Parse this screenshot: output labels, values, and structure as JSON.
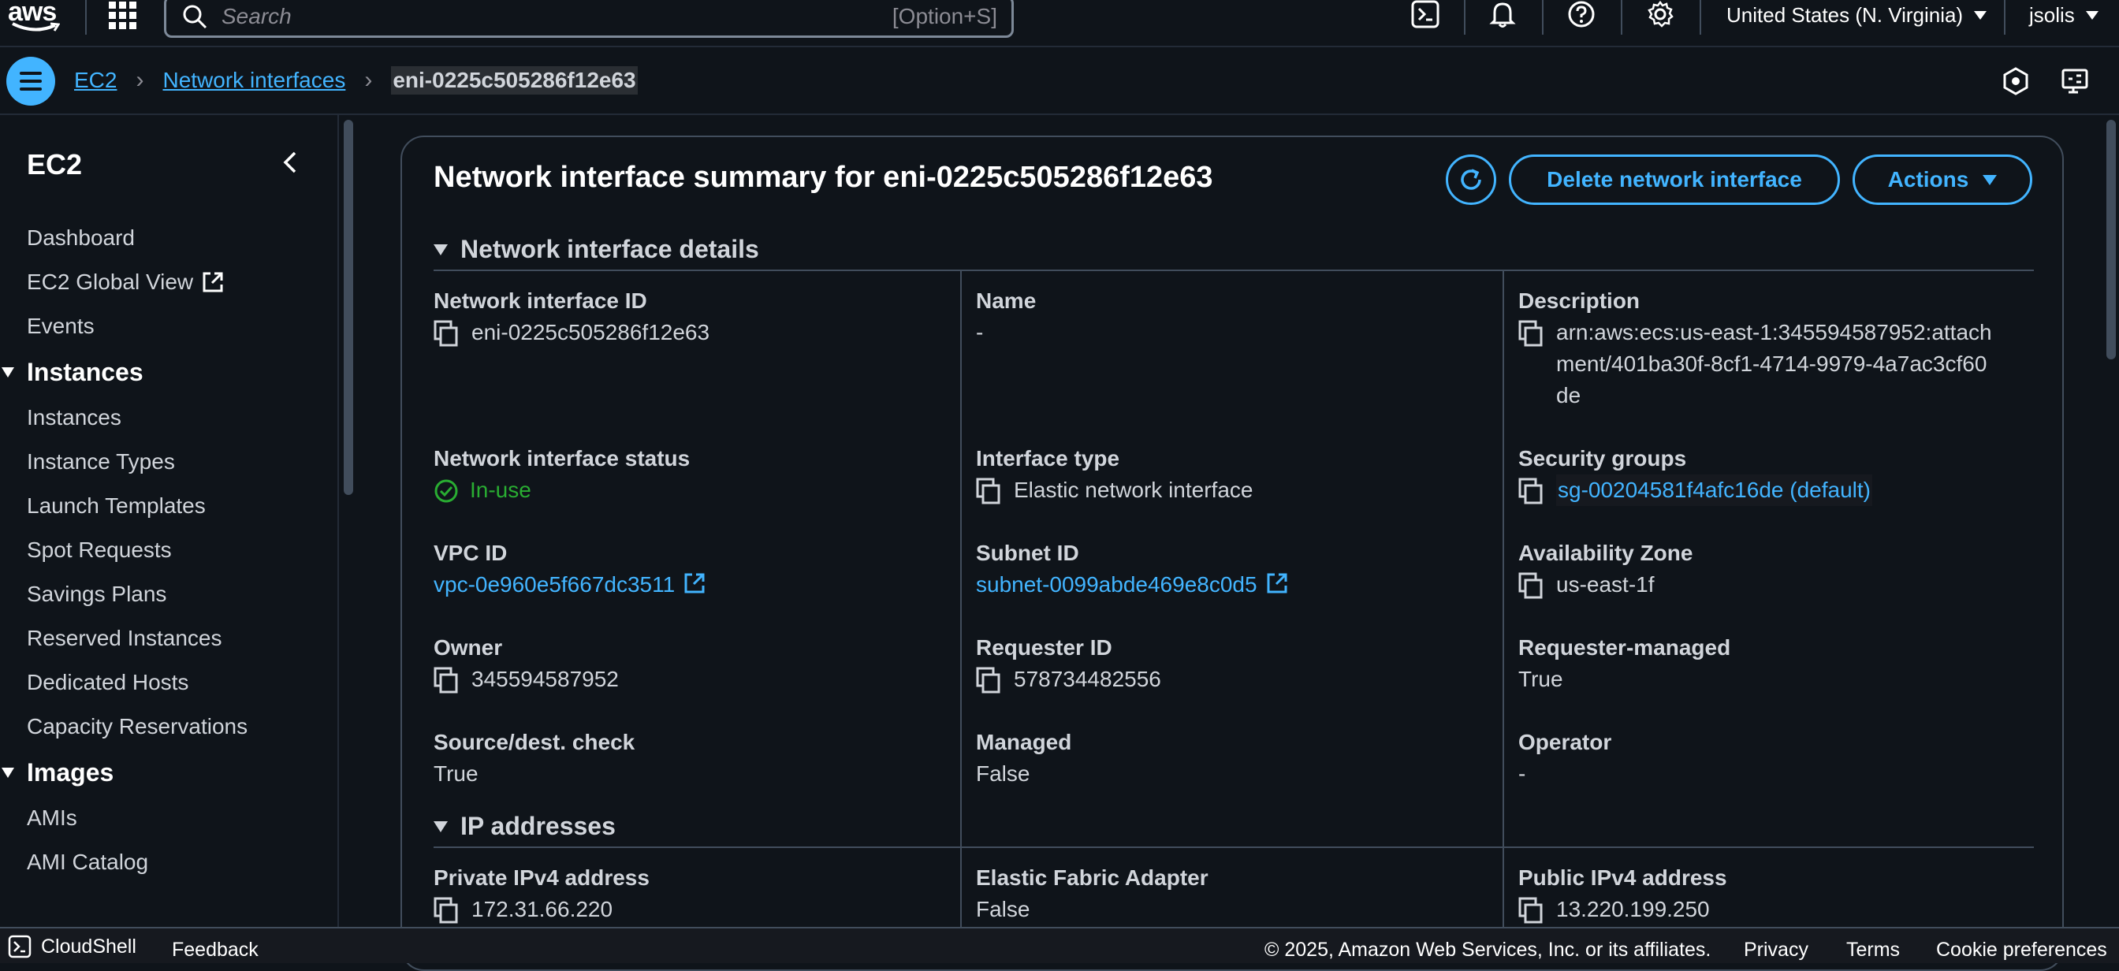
{
  "topnav": {
    "logo": "aws",
    "search_placeholder": "Search",
    "search_shortcut": "[Option+S]",
    "region": "United States (N. Virginia)",
    "user": "jsolis"
  },
  "breadcrumb": {
    "items": [
      "EC2",
      "Network interfaces"
    ],
    "current": "eni-0225c505286f12e63"
  },
  "sidebar": {
    "title": "EC2",
    "items_top": [
      "Dashboard",
      "EC2 Global View",
      "Events"
    ],
    "instances_head": "Instances",
    "instances_items": [
      "Instances",
      "Instance Types",
      "Launch Templates",
      "Spot Requests",
      "Savings Plans",
      "Reserved Instances",
      "Dedicated Hosts",
      "Capacity Reservations"
    ],
    "images_head": "Images",
    "images_items": [
      "AMIs",
      "AMI Catalog"
    ]
  },
  "main": {
    "title": "Network interface summary for eni-0225c505286f12e63",
    "delete_label": "Delete network interface",
    "actions_label": "Actions",
    "details_section": "Network interface details",
    "ip_section": "IP addresses",
    "fields": {
      "eni_id": {
        "label": "Network interface ID",
        "value": "eni-0225c505286f12e63"
      },
      "name": {
        "label": "Name",
        "value": "-"
      },
      "description": {
        "label": "Description",
        "value": "arn:aws:ecs:us-east-1:345594587952:attachment/401ba30f-8cf1-4714-9979-4a7ac3cf60de"
      },
      "status": {
        "label": "Network interface status",
        "value": "In-use"
      },
      "interface_type": {
        "label": "Interface type",
        "value": "Elastic network interface"
      },
      "security_groups": {
        "label": "Security groups",
        "value": "sg-00204581f4afc16de (default)"
      },
      "vpc_id": {
        "label": "VPC ID",
        "value": "vpc-0e960e5f667dc3511"
      },
      "subnet_id": {
        "label": "Subnet ID",
        "value": "subnet-0099abde469e8c0d5"
      },
      "az": {
        "label": "Availability Zone",
        "value": "us-east-1f"
      },
      "owner": {
        "label": "Owner",
        "value": "345594587952"
      },
      "requester_id": {
        "label": "Requester ID",
        "value": "578734482556"
      },
      "requester_managed": {
        "label": "Requester-managed",
        "value": "True"
      },
      "src_dest": {
        "label": "Source/dest. check",
        "value": "True"
      },
      "managed": {
        "label": "Managed",
        "value": "False"
      },
      "operator": {
        "label": "Operator",
        "value": "-"
      },
      "private_ipv4": {
        "label": "Private IPv4 address",
        "value": "172.31.66.220"
      },
      "efa": {
        "label": "Elastic Fabric Adapter",
        "value": "False"
      },
      "public_ipv4": {
        "label": "Public IPv4 address",
        "value": "13.220.199.250"
      }
    }
  },
  "footer": {
    "cloudshell": "CloudShell",
    "feedback": "Feedback",
    "copyright": "© 2025, Amazon Web Services, Inc. or its affiliates.",
    "privacy": "Privacy",
    "terms": "Terms",
    "cookies": "Cookie preferences"
  },
  "colors": {
    "link": "#42b4ff",
    "success": "#29ad32",
    "background": "#0f141a"
  }
}
